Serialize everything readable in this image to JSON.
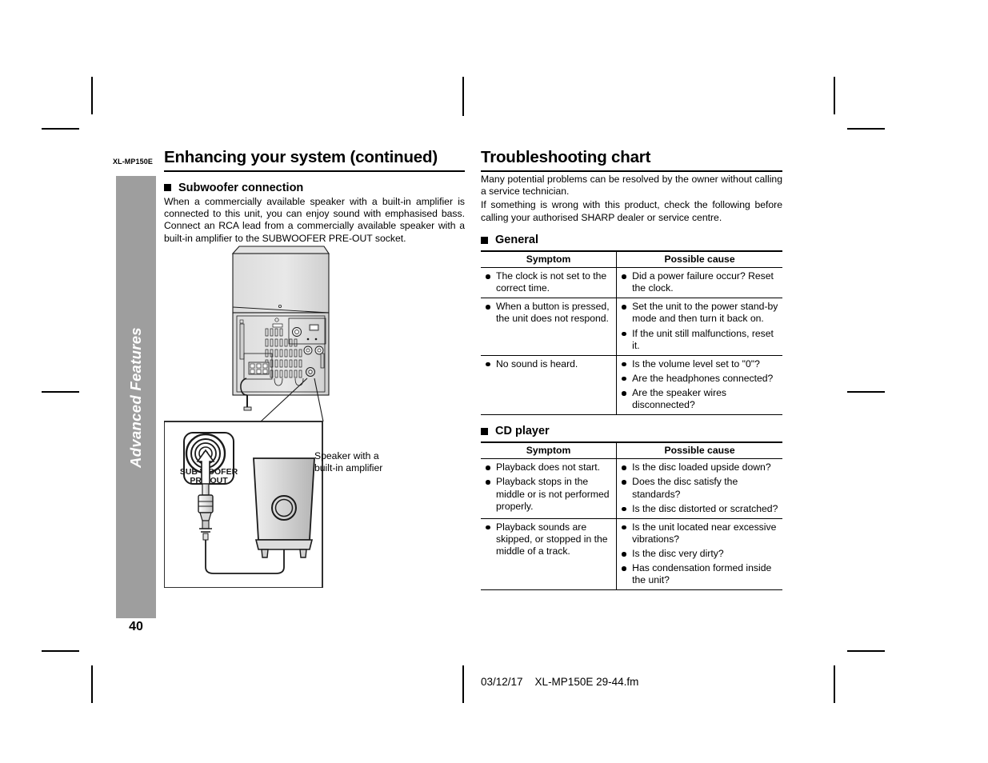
{
  "document": {
    "model_code": "XL-MP150E",
    "page_number": "40",
    "side_tab_label": "Advanced Features",
    "side_tab_color": "#9e9e9e",
    "footer": "03/12/17    XL-MP150E 29-44.fm"
  },
  "left_column": {
    "title": "Enhancing your system (continued)",
    "section": {
      "heading": "Subwoofer connection",
      "paragraph": "When a commercially available speaker with a built-in amplifier is connected to this unit, you can enjoy sound with emphasised bass. Connect an RCA lead from a commercially available speaker with a built-in amplifier to the SUBWOOFER PRE-OUT socket."
    },
    "figure": {
      "jack_label_line1": "SUB WOOFER",
      "jack_label_line2": "PRE-OUT",
      "speaker_caption": "Speaker with a\nbuilt-in amplifier"
    }
  },
  "right_column": {
    "title": "Troubleshooting chart",
    "intro_line1": "Many potential problems can be resolved by the owner without calling a service technician.",
    "intro_line2": "If something is wrong with this product, check the following before calling your authorised SHARP dealer or service centre.",
    "sections": [
      {
        "heading": "General",
        "columns": [
          "Symptom",
          "Possible cause"
        ],
        "rows": [
          {
            "symptom": [
              "The clock is not set to the correct time."
            ],
            "cause": [
              "Did a power failure occur? Reset the clock."
            ]
          },
          {
            "symptom": [
              "When a button is pressed, the unit does not respond."
            ],
            "cause": [
              "Set the unit to the power stand-by mode and then turn it back on.",
              "If the unit still malfunctions, reset it."
            ]
          },
          {
            "symptom": [
              "No sound is heard."
            ],
            "cause": [
              "Is the volume level set to \"0\"?",
              "Are the headphones connected?",
              "Are the speaker wires disconnected?"
            ]
          }
        ]
      },
      {
        "heading": "CD player",
        "columns": [
          "Symptom",
          "Possible cause"
        ],
        "rows": [
          {
            "symptom": [
              "Playback does not start.",
              "Playback stops in the middle or is not performed properly."
            ],
            "cause": [
              "Is the disc loaded upside down?",
              "Does the disc satisfy the standards?",
              "Is the disc distorted or scratched?"
            ]
          },
          {
            "symptom": [
              "Playback sounds are skipped, or stopped in the middle of a track."
            ],
            "cause": [
              "Is the unit located near excessive vibrations?",
              "Is the disc very dirty?",
              "Has condensation formed inside the unit?"
            ]
          }
        ]
      }
    ]
  }
}
